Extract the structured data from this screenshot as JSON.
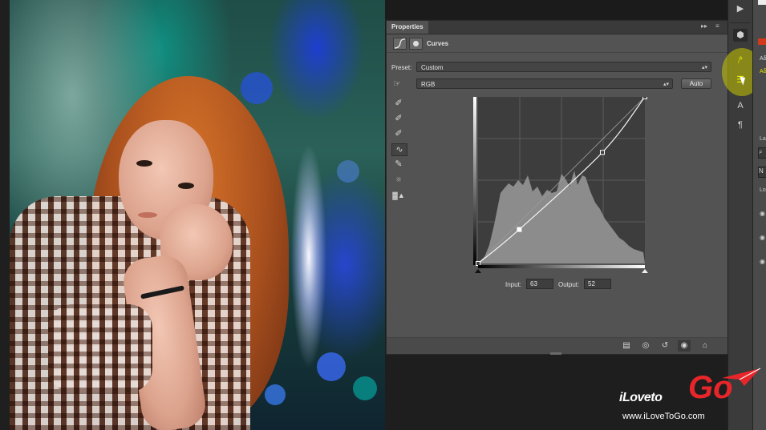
{
  "panel": {
    "tab_label": "Properties",
    "menu_glyph": "▸▸",
    "options_glyph": "≡",
    "title": "Curves",
    "preset_label": "Preset:",
    "preset_value": "Custom",
    "channel_value": "RGB",
    "auto_label": "Auto",
    "input_label": "Input:",
    "input_value": "63",
    "output_label": "Output:",
    "output_value": "52"
  },
  "right_strip": {
    "text_a_label": "A",
    "adj_label_1": "Aδ",
    "adj_label_2": "Aδ",
    "n_label": "N",
    "lo_label": "Lo",
    "la_label": "La"
  },
  "watermark": {
    "brand_prefix": "iLoveto",
    "brand_suffix": "Go",
    "url": "www.iLoveToGo.com"
  },
  "colors": {
    "panel_bg": "#535353",
    "highlight": "#e8e800",
    "brand_red": "#e8262a"
  },
  "curve": {
    "points": [
      [
        0,
        0
      ],
      [
        63,
        52
      ],
      [
        190,
        170
      ],
      [
        255,
        255
      ]
    ]
  }
}
